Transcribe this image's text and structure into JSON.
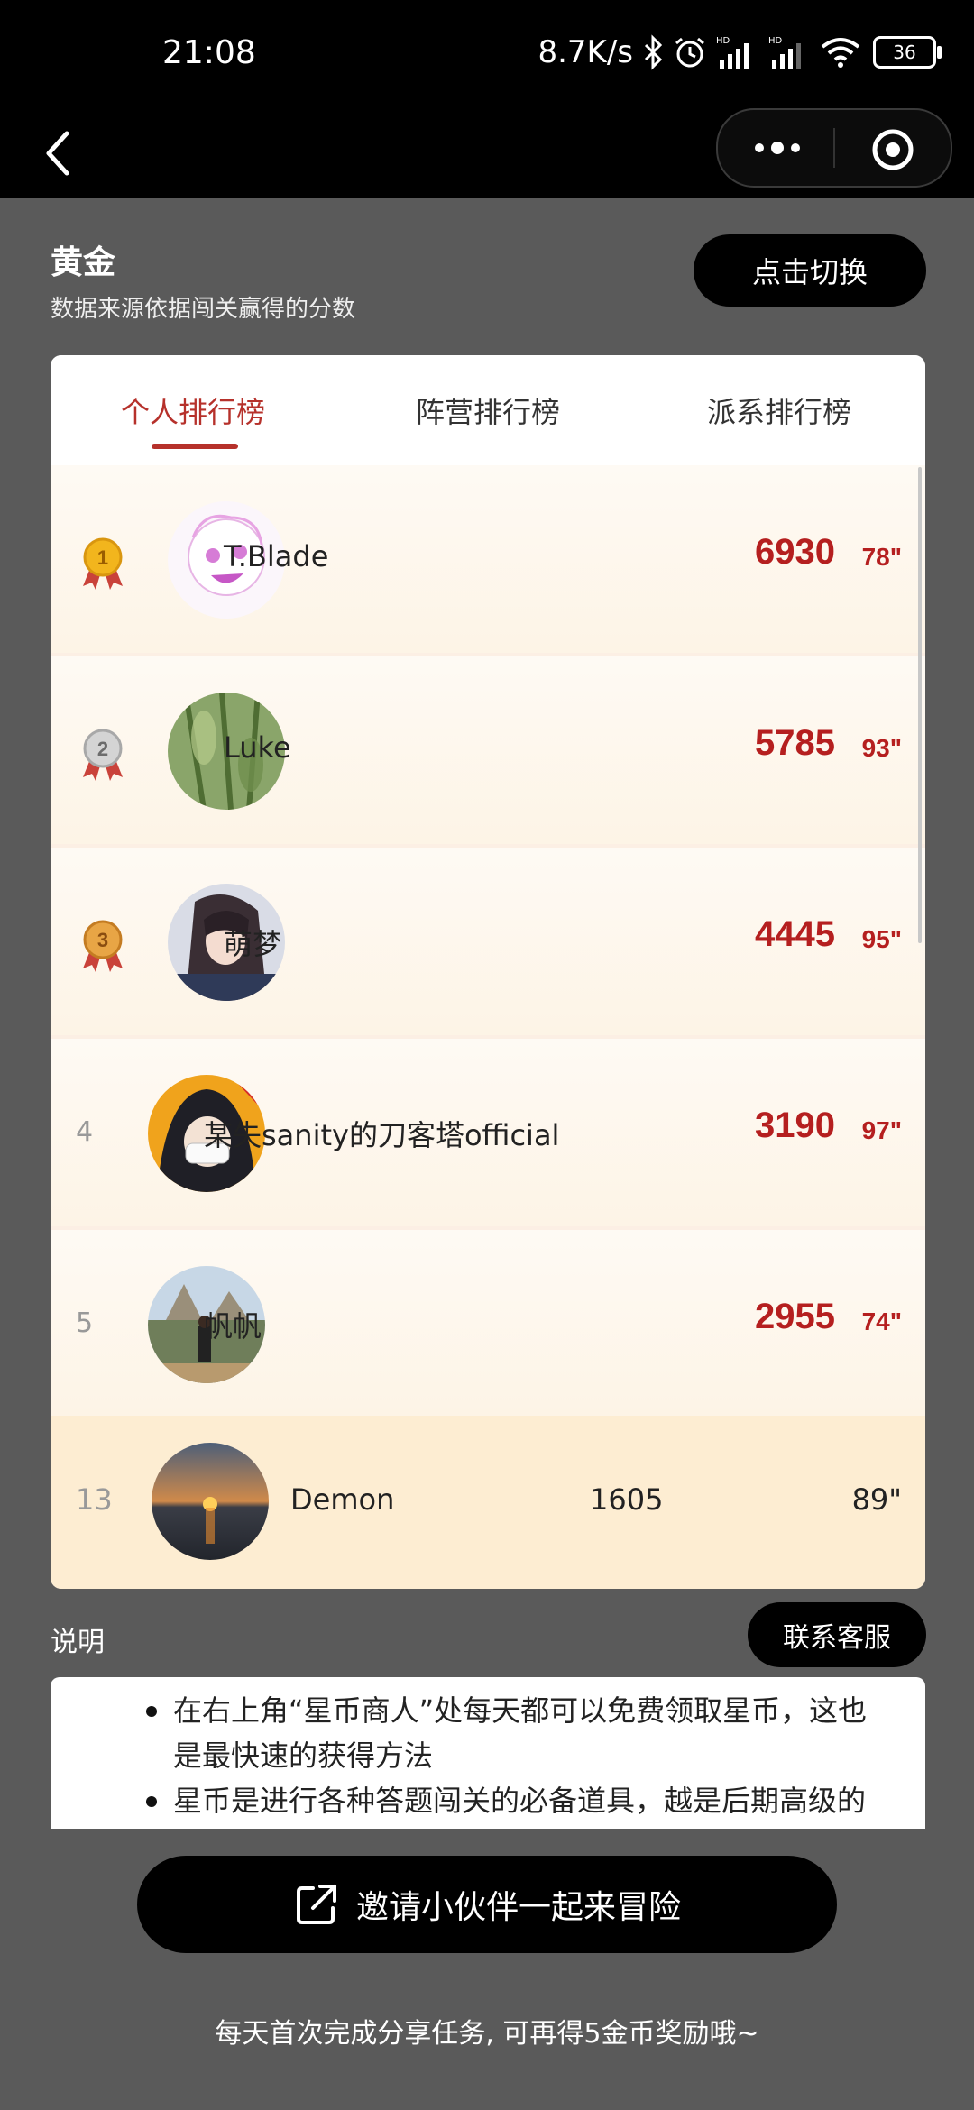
{
  "status_bar": {
    "time": "21:08",
    "net_speed": "8.7K/s",
    "battery": "36"
  },
  "header": {
    "tier": "黄金",
    "subtitle": "数据来源依据闯关赢得的分数",
    "switch_label": "点击切换"
  },
  "tabs": [
    {
      "label": "个人排行榜",
      "active": true
    },
    {
      "label": "阵营排行榜",
      "active": false
    },
    {
      "label": "派系排行榜",
      "active": false
    }
  ],
  "leaderboard": [
    {
      "rank": "1",
      "name": "T.Blade",
      "score": "6930",
      "duration": "78\"",
      "medal": "gold"
    },
    {
      "rank": "2",
      "name": "Luke",
      "score": "5785",
      "duration": "93\"",
      "medal": "silver"
    },
    {
      "rank": "3",
      "name": "萌梦",
      "score": "4445",
      "duration": "95\"",
      "medal": "bronze"
    },
    {
      "rank": "4",
      "name": "某失sanity的刀客塔official",
      "score": "3190",
      "duration": "97\"",
      "medal": ""
    },
    {
      "rank": "5",
      "name": "帆帆",
      "score": "2955",
      "duration": "74\"",
      "medal": ""
    }
  ],
  "self_row": {
    "rank": "13",
    "name": "Demon",
    "score": "1605",
    "duration": "89\""
  },
  "description": {
    "label": "说明",
    "service_label": "联系客服",
    "items": [
      "在右上角“星币商人”处每天都可以免费领取星币，这也是最快速的获得方法",
      "星币是进行各种答题闯关的必备道具，越是后期高级的"
    ]
  },
  "invite_label": "邀请小伙伴一起来冒险",
  "footer_tip": "每天首次完成分享任务, 可再得5金币奖励哦~",
  "colors": {
    "accent": "#b6312b",
    "score": "#b51f1f",
    "background": "#5a5a5a"
  }
}
